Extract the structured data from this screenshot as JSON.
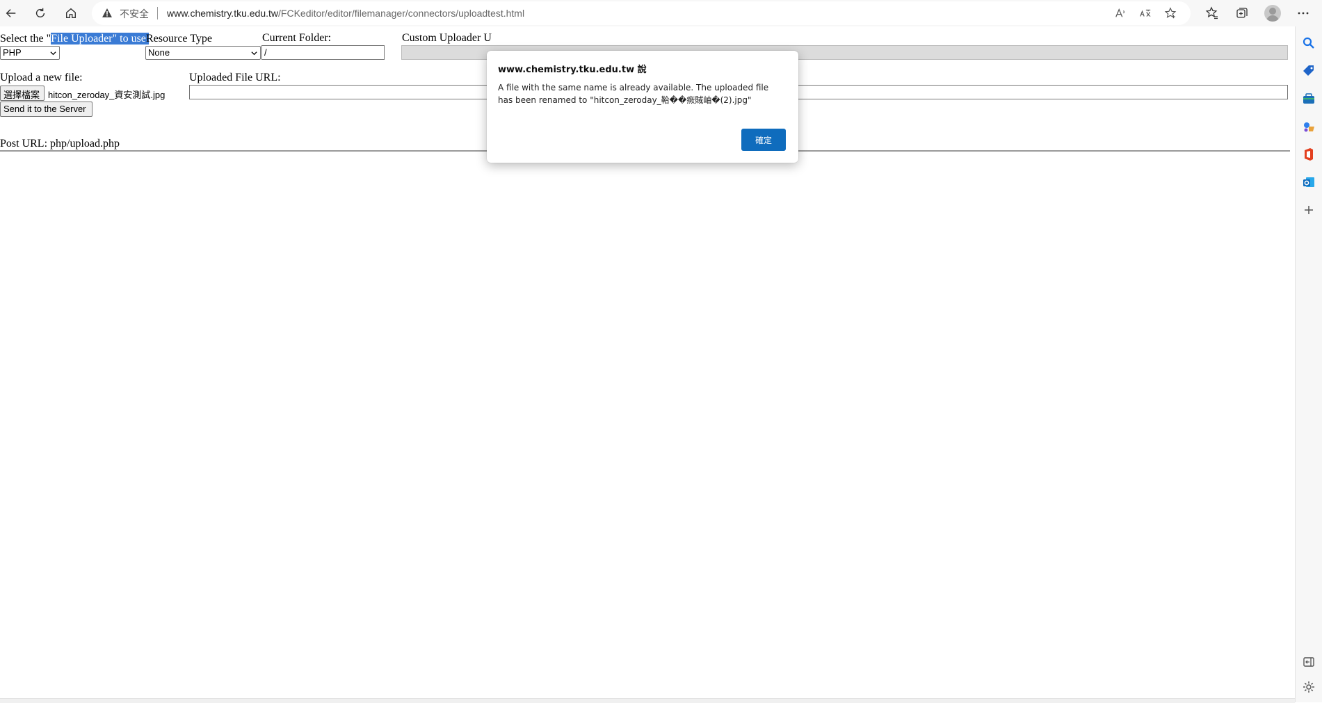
{
  "browser": {
    "security_label": "不安全",
    "url_host": "www.chemistry.tku.edu.tw",
    "url_path": "/FCKeditor/editor/filemanager/connectors/uploadtest.html"
  },
  "form": {
    "uploader_label_pre": "Select the \"",
    "uploader_label_highlight": "File Uploader\" to use:",
    "uploader_value": "PHP",
    "resource_type_label": "Resource Type",
    "resource_type_value": "None",
    "current_folder_label": "Current Folder:",
    "current_folder_value": "/",
    "custom_uploader_label": "Custom Uploader U",
    "upload_label": "Upload a new file:",
    "choose_file_button": "選擇檔案",
    "chosen_file_name": "hitcon_zeroday_資安測試.jpg",
    "send_button": "Send it to the Server",
    "uploaded_url_label": "Uploaded File URL:",
    "post_url": "Post URL: php/upload.php"
  },
  "dialog": {
    "title": "www.chemistry.tku.edu.tw 說",
    "message": "A file with the same name is already available. The uploaded file has been renamed to \"hitcon_zeroday_鞈��瘚賊岫�(2).jpg\"",
    "ok_button": "確定"
  }
}
